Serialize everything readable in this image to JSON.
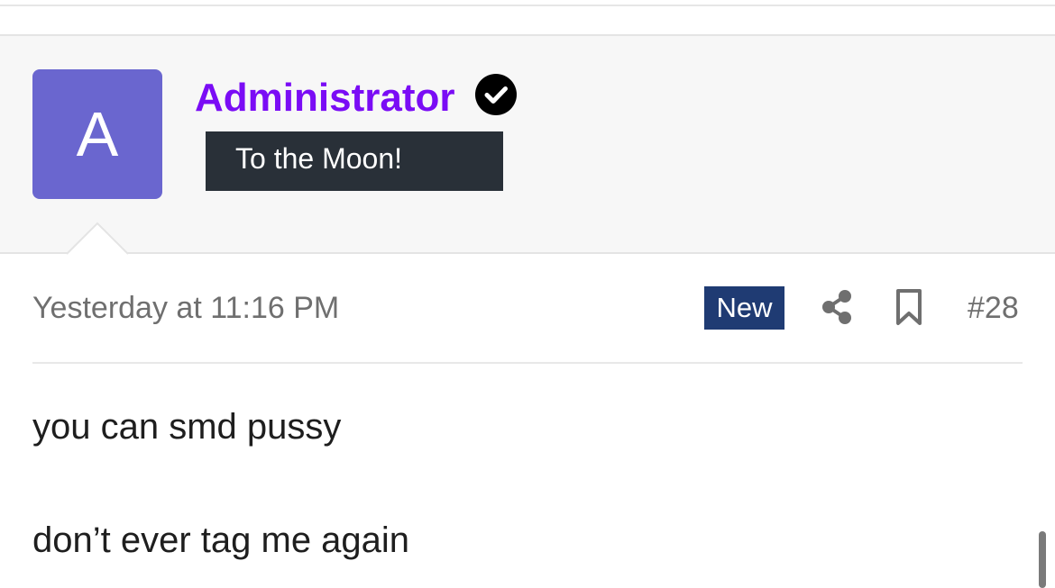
{
  "post": {
    "author": {
      "avatar_letter": "A",
      "avatar_color": "#6a66cf",
      "name": "Administrator",
      "name_color": "#7a0cf5",
      "verified_icon": "verified-check-icon",
      "title": "To the Moon!"
    },
    "meta": {
      "timestamp": "Yesterday at 11:16 PM",
      "new_badge": "New",
      "share_icon": "share-icon",
      "bookmark_icon": "bookmark-icon",
      "post_number": "#28"
    },
    "body": {
      "lines": [
        "you can smd pussy",
        "don’t ever tag me again"
      ]
    }
  }
}
